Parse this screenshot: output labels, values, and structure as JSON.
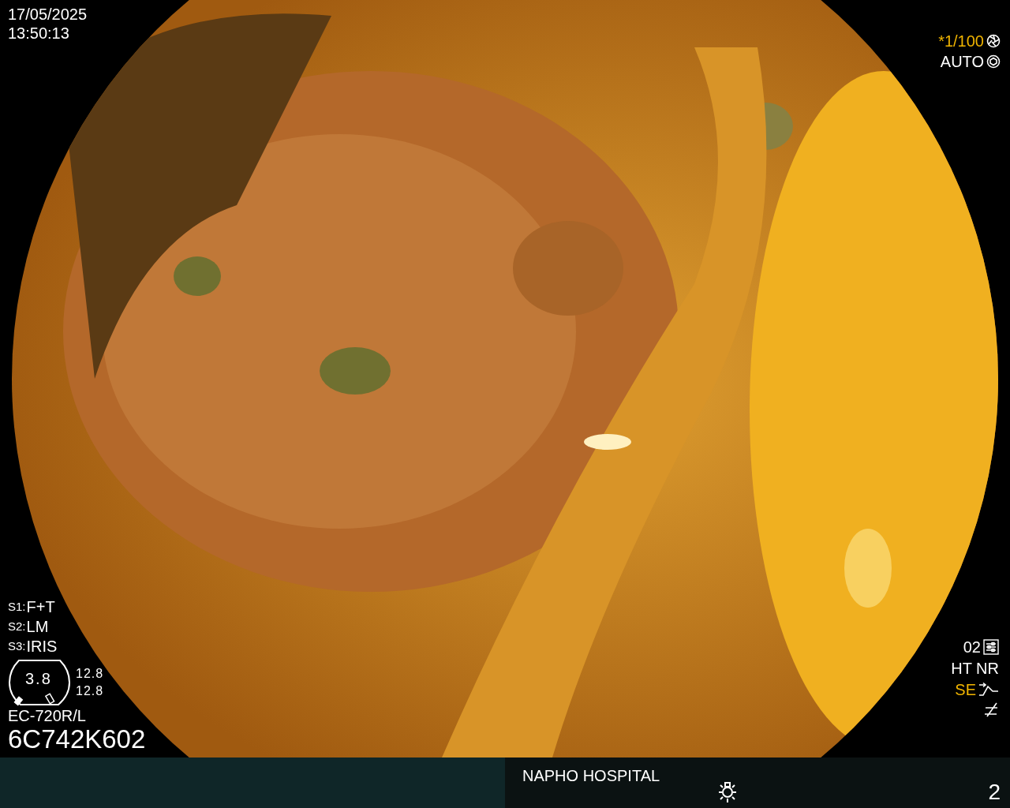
{
  "timestamp": {
    "date": "17/05/2025",
    "time": "13:50:13"
  },
  "exposure": [
    {
      "text": "*1/100",
      "highlighted": true,
      "kind": "shutter"
    },
    {
      "text": "AUTO",
      "highlighted": false,
      "kind": "iris"
    }
  ],
  "scope_switches": [
    {
      "label": "S1:",
      "value": "F+T"
    },
    {
      "label": "S2:",
      "value": "LM"
    },
    {
      "label": "S3:",
      "value": "IRIS"
    }
  ],
  "gauge": {
    "value": "3.8",
    "readings": [
      "12.8",
      "12.8"
    ]
  },
  "scope": {
    "model": "EC-720R/L",
    "serial": "6C742K602"
  },
  "enhancement": [
    {
      "text": "02",
      "highlighted": false,
      "kind": "sliders"
    },
    {
      "text": "HT NR",
      "highlighted": false,
      "kind": "plain"
    },
    {
      "text": "SE",
      "highlighted": true,
      "kind": "curve"
    },
    {
      "kind": "slash"
    }
  ],
  "footer": {
    "hospital": "NAPHO HOSPITAL",
    "page": "2"
  }
}
